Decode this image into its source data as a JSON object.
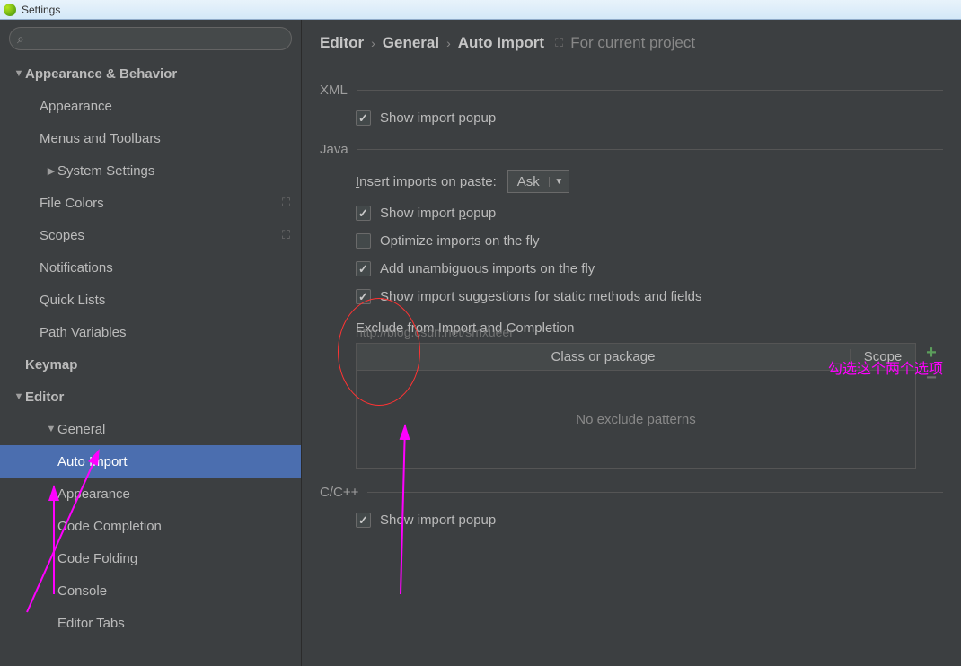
{
  "window": {
    "title": "Settings"
  },
  "search": {
    "placeholder": ""
  },
  "sidebar": {
    "items": [
      {
        "label": "Appearance & Behavior",
        "level": 0,
        "expanded": true,
        "bold": true
      },
      {
        "label": "Appearance",
        "level": 1
      },
      {
        "label": "Menus and Toolbars",
        "level": 1
      },
      {
        "label": "System Settings",
        "level": 1,
        "collapsed": true
      },
      {
        "label": "File Colors",
        "level": 1,
        "suffix": "proj"
      },
      {
        "label": "Scopes",
        "level": 1,
        "suffix": "proj"
      },
      {
        "label": "Notifications",
        "level": 1
      },
      {
        "label": "Quick Lists",
        "level": 1
      },
      {
        "label": "Path Variables",
        "level": 1
      },
      {
        "label": "Keymap",
        "level": 0,
        "bold": true,
        "noToggle": true
      },
      {
        "label": "Editor",
        "level": 0,
        "expanded": true,
        "bold": true
      },
      {
        "label": "General",
        "level": 1,
        "expanded": true
      },
      {
        "label": "Auto Import",
        "level": 2,
        "selected": true
      },
      {
        "label": "Appearance",
        "level": 2
      },
      {
        "label": "Code Completion",
        "level": 2
      },
      {
        "label": "Code Folding",
        "level": 2
      },
      {
        "label": "Console",
        "level": 2
      },
      {
        "label": "Editor Tabs",
        "level": 2
      }
    ]
  },
  "breadcrumb": {
    "parts": [
      "Editor",
      "General",
      "Auto Import"
    ],
    "scope": "For current project"
  },
  "sections": {
    "xml": {
      "title": "XML",
      "show_popup": "Show import popup"
    },
    "java": {
      "title": "Java",
      "insert_label_pre": "I",
      "insert_label": "nsert imports on paste:",
      "insert_value": "Ask",
      "show_popup_pre": "Show import ",
      "show_popup_u": "p",
      "show_popup_post": "opup",
      "optimize": "Optimize imports on the fly",
      "unambiguous": "Add unambiguous imports on the fly",
      "suggestions": "Show import suggestions for static methods and fields",
      "exclude_title": "Exclude from Import and Completion",
      "col_class": "Class or package",
      "col_scope": "Scope",
      "empty": "No exclude patterns"
    },
    "ccpp": {
      "title": "C/C++",
      "show_popup": "Show import popup"
    }
  },
  "annotations": {
    "watermark": "http://blog.csdn.net/smxueer",
    "chinese": "勾选这个两个选项"
  }
}
